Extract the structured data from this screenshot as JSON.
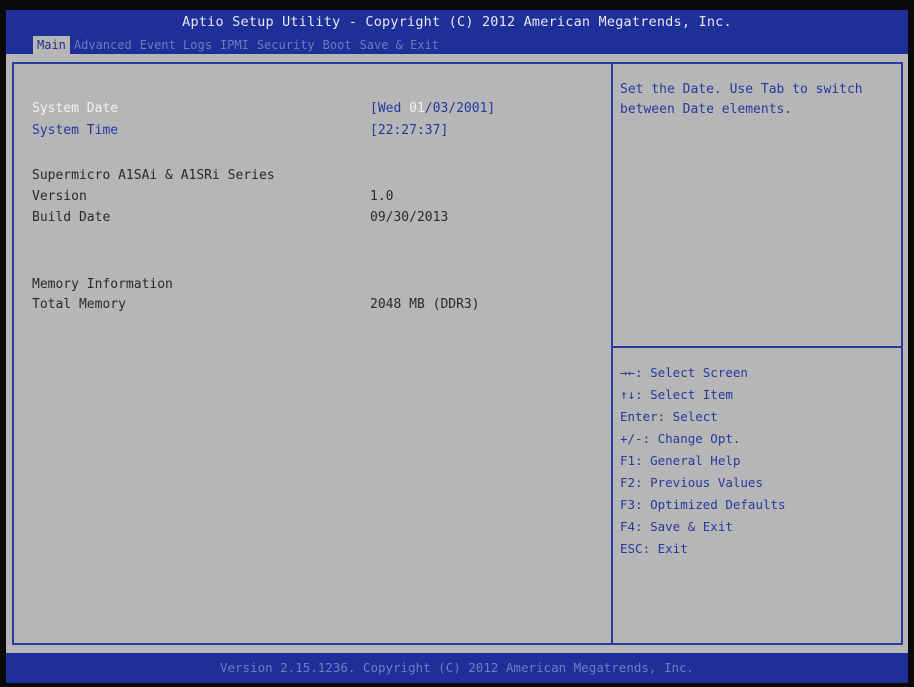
{
  "header": {
    "title": "Aptio Setup Utility - Copyright (C) 2012 American Megatrends, Inc.",
    "tabs": [
      {
        "label": "Main",
        "active": true
      },
      {
        "label": "Advanced"
      },
      {
        "label": "Event Logs"
      },
      {
        "label": "IPMI"
      },
      {
        "label": "Security"
      },
      {
        "label": "Boot"
      },
      {
        "label": "Save & Exit"
      }
    ]
  },
  "main": {
    "system_date": {
      "label": "System Date",
      "value_prefix": "[Wed ",
      "value_highlight": "01",
      "value_suffix": "/03/2001]"
    },
    "system_time": {
      "label": "System Time",
      "value": "[22:27:37]"
    },
    "product": {
      "label": "Supermicro A1SAi & A1SRi Series"
    },
    "version": {
      "label": "Version",
      "value": "1.0"
    },
    "build_date": {
      "label": "Build Date",
      "value": "09/30/2013"
    },
    "memory_info": {
      "label": "Memory Information"
    },
    "total_memory": {
      "label": "Total Memory",
      "value": "2048 MB (DDR3)"
    }
  },
  "help": {
    "text": "Set the Date. Use Tab to switch between Date elements."
  },
  "keys": [
    "→←: Select Screen",
    "↑↓: Select Item",
    "Enter: Select",
    "+/-: Change Opt.",
    "F1: General Help",
    "F2: Previous Values",
    "F3: Optimized Defaults",
    "F4: Save & Exit",
    "ESC: Exit"
  ],
  "footer": {
    "text": "Version 2.15.1236. Copyright (C) 2012 American Megatrends, Inc."
  },
  "colors": {
    "bar": "#1e2f9a",
    "panel": "#b6b6b6",
    "accent_text": "#253a9e",
    "selected_text": "#f2f2f2"
  }
}
